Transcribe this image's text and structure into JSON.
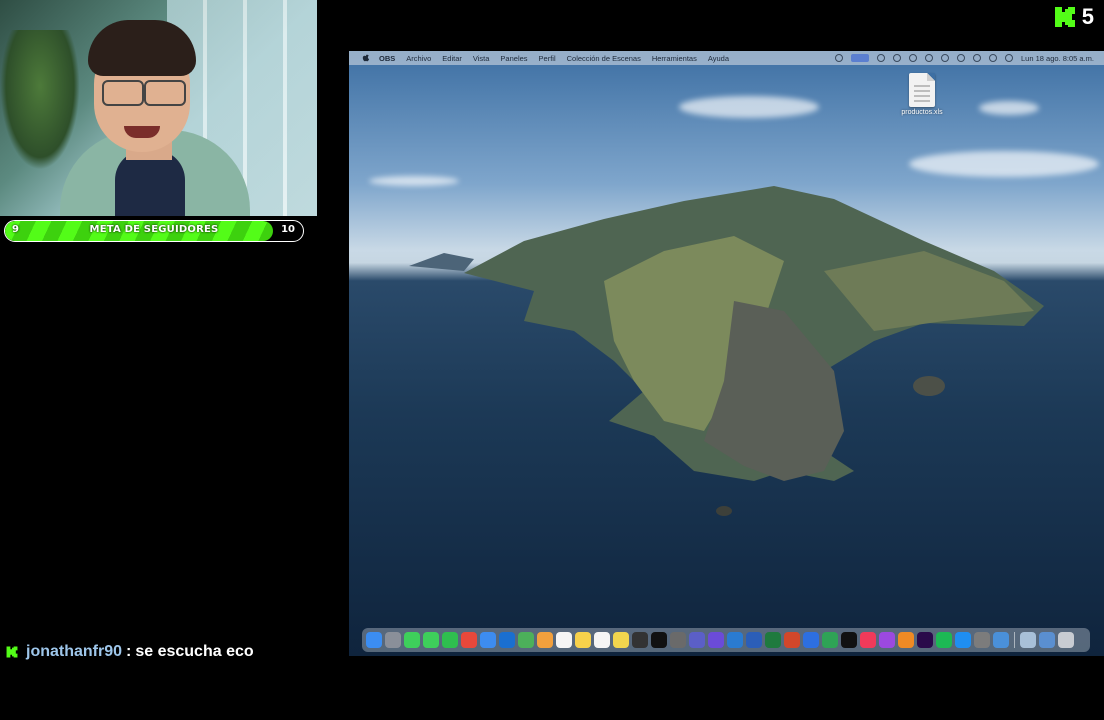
{
  "stream": {
    "follower_goal": {
      "title": "META DE SEGUIDORES",
      "current": "9",
      "target": "10",
      "progress": 0.9
    },
    "viewer_count": "5",
    "accent_color": "#53fc18"
  },
  "mac": {
    "menu": [
      "OBS",
      "Archivo",
      "Editar",
      "Vista",
      "Paneles",
      "Perfil",
      "Colección de Escenas",
      "Herramientas",
      "Ayuda"
    ],
    "clock": "Lun 18 ago.  8:05 a.m.",
    "desktop_file": "productos.xls",
    "dock_apps": [
      "finder",
      "launchpad",
      "facetime",
      "messages",
      "whatsapp",
      "chrome",
      "mail",
      "outlook",
      "maps",
      "photos",
      "calendar",
      "notes",
      "reminders",
      "stickies",
      "obs",
      "capcut",
      "brackets",
      "teams",
      "imovie",
      "vscode",
      "word",
      "excel",
      "powerpoint",
      "keynote",
      "numbers",
      "appletv",
      "music",
      "podcasts",
      "books",
      "premiere",
      "spotify",
      "app-store",
      "system-preferences",
      "preview",
      "finder-folder",
      "downloads",
      "trash"
    ]
  },
  "chat": {
    "username": "jonathanfr90",
    "separator": ":",
    "message": "se escucha eco"
  }
}
